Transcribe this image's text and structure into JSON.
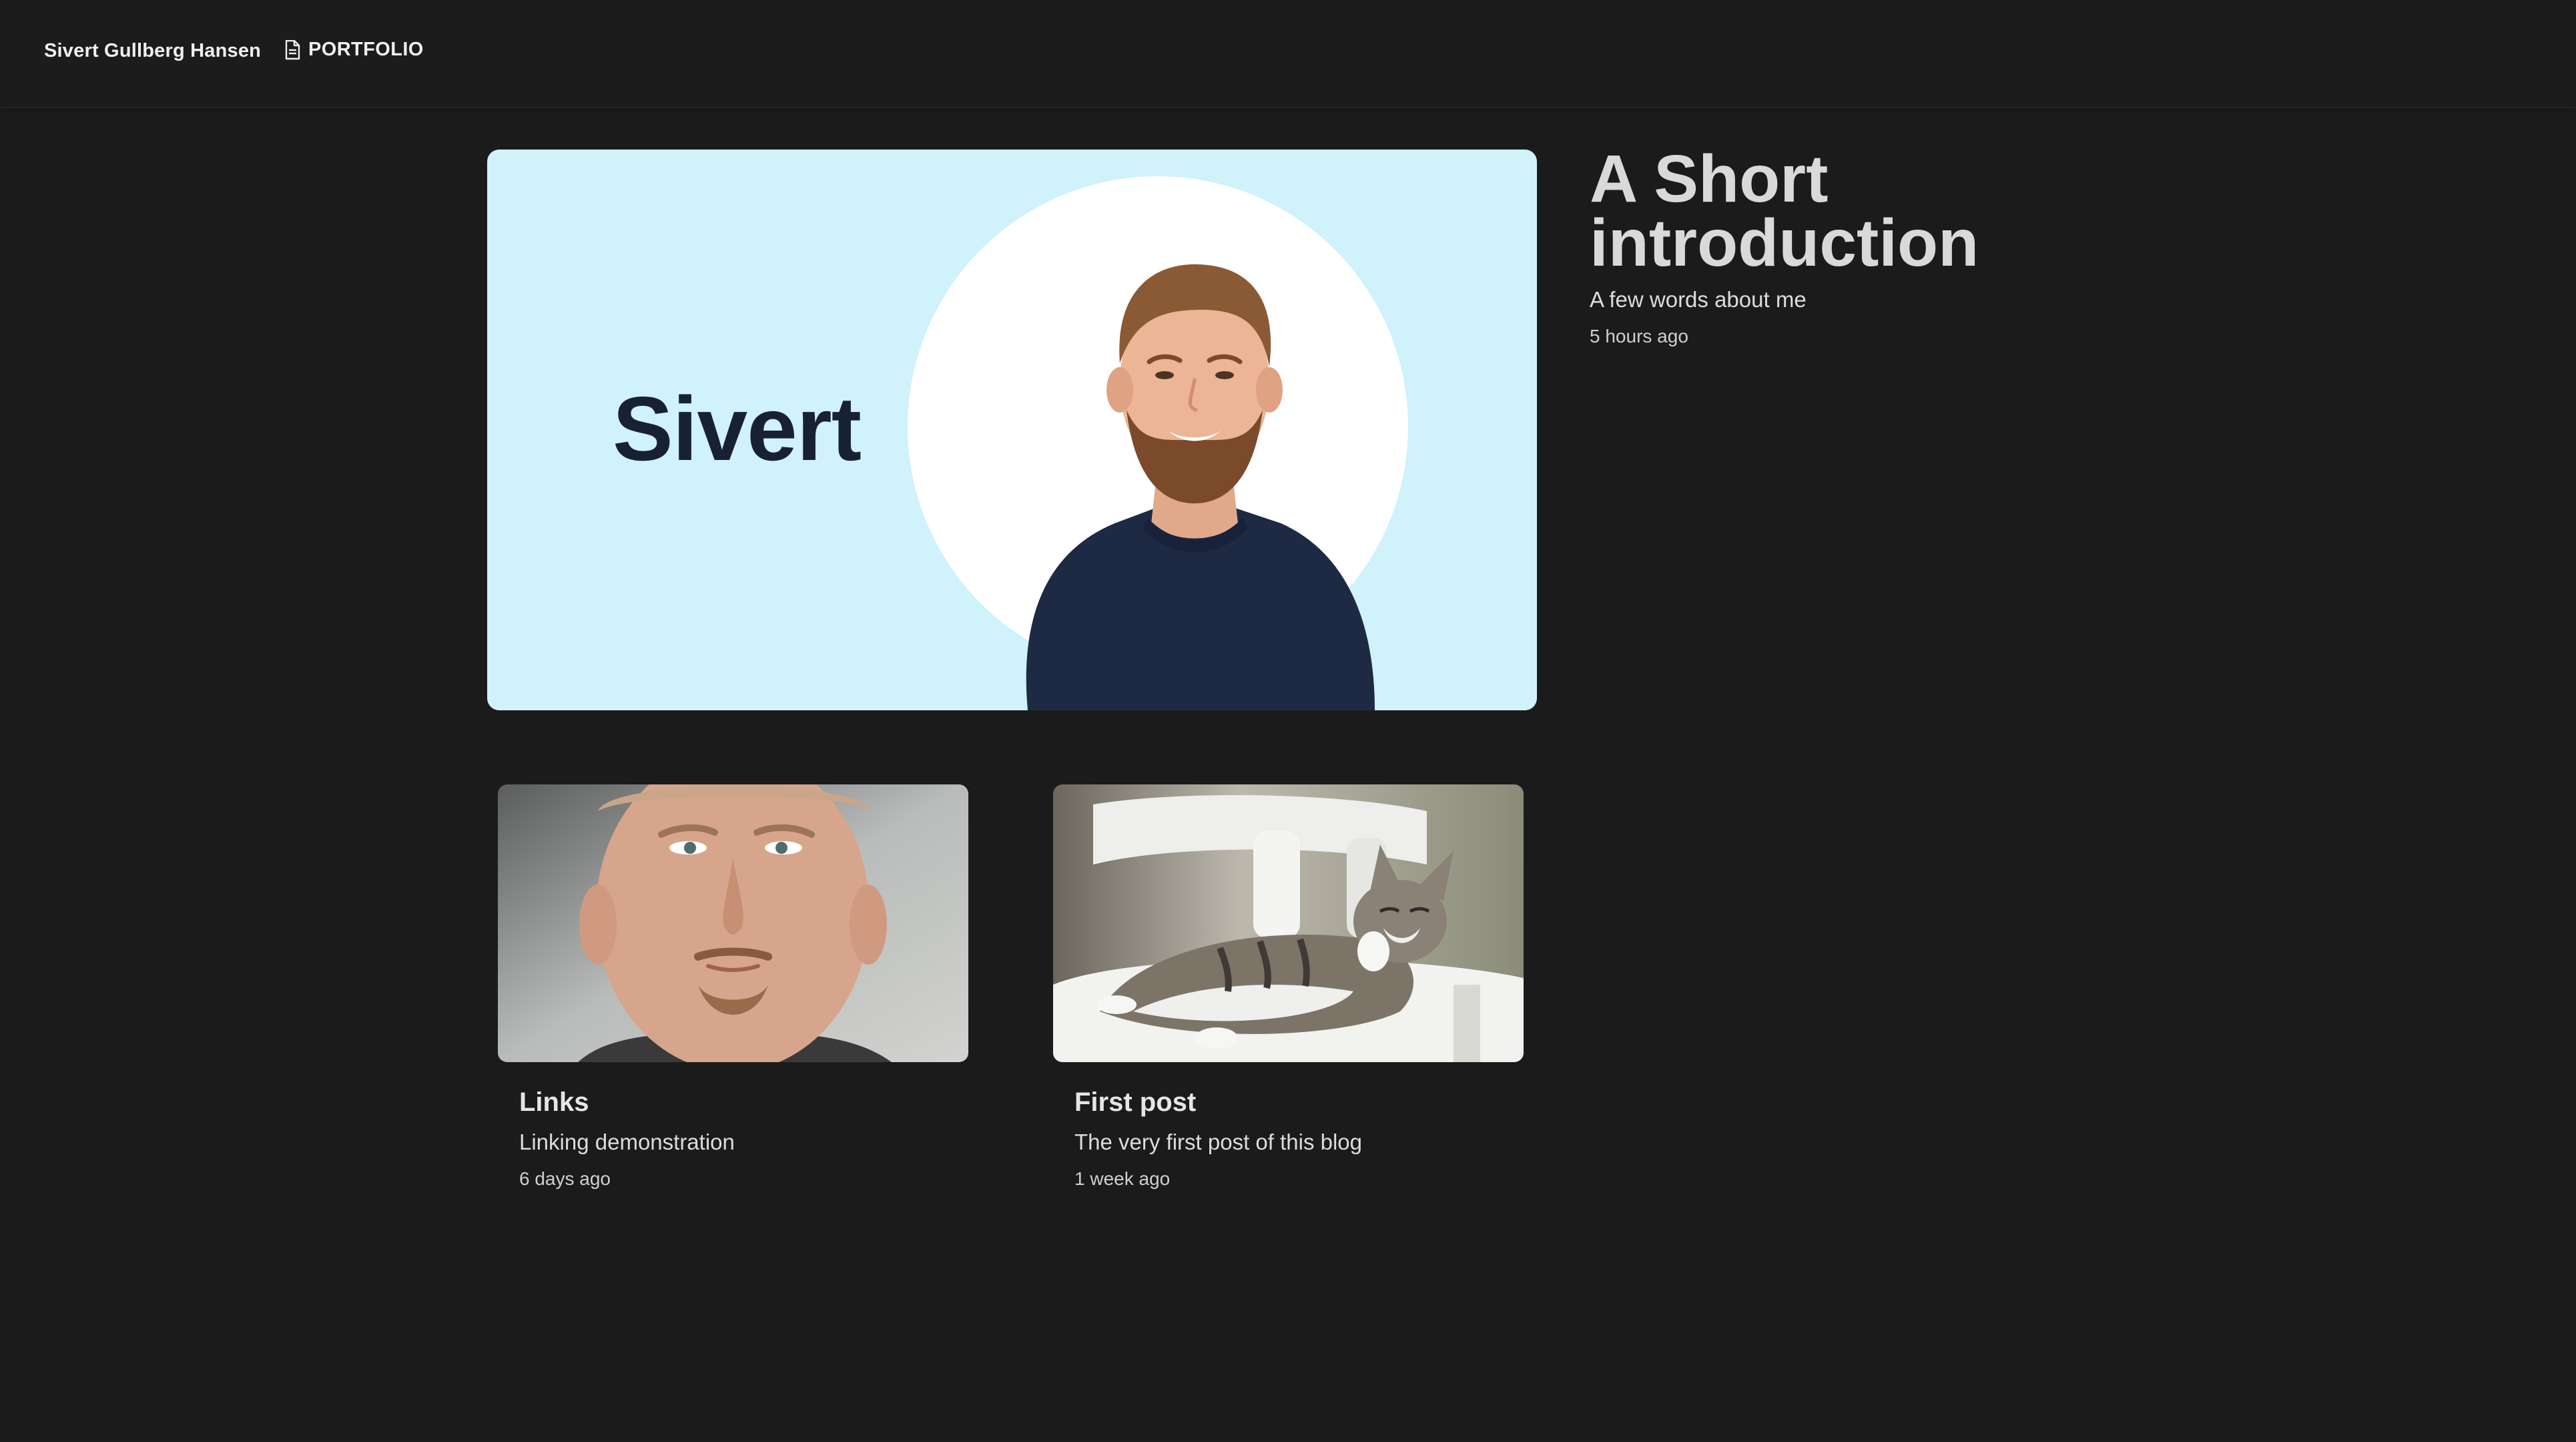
{
  "header": {
    "brand": "Sivert Gullberg Hansen",
    "nav": [
      {
        "label": "PORTFOLIO",
        "icon": "document-icon"
      }
    ]
  },
  "hero": {
    "image_text": "Sivert",
    "title": "A Short introduction",
    "subtitle": "A few words about me",
    "time": "5 hours ago"
  },
  "posts": [
    {
      "title": "Links",
      "description": "Linking demonstration",
      "time": "6 days ago",
      "image": "portrait-photo"
    },
    {
      "title": "First post",
      "description": "The very first post of this blog",
      "time": "1 week ago",
      "image": "cat-photo"
    }
  ],
  "colors": {
    "page_background": "#1b1b1b",
    "hero_image_background": "#cff2fb",
    "hero_image_text": "#182134",
    "text": "#e8e8e8"
  }
}
